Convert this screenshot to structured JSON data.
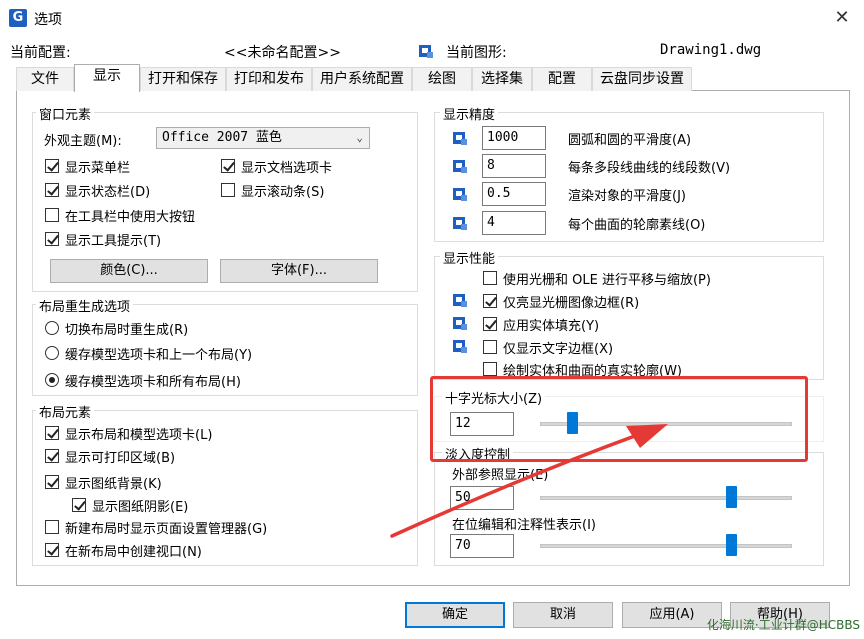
{
  "window": {
    "title": "选项",
    "logo_letter": "G",
    "close_glyph": "✕"
  },
  "profile": {
    "current_config_label": "当前配置:",
    "current_config_value": "<<未命名配置>>",
    "current_drawing_label": "当前图形:",
    "current_drawing_value": "Drawing1.dwg"
  },
  "tabs": [
    "文件",
    "显示",
    "打开和保存",
    "打印和发布",
    "用户系统配置",
    "绘图",
    "选择集",
    "配置",
    "云盘同步设置"
  ],
  "active_tab": "显示",
  "window_elements": {
    "title": "窗口元素",
    "theme_label": "外观主题(M):",
    "theme_value": "Office 2007 蓝色",
    "checkboxes": [
      {
        "label": "显示菜单栏",
        "checked": true
      },
      {
        "label": "显示文档选项卡",
        "checked": true
      },
      {
        "label": "显示状态栏(D)",
        "checked": true
      },
      {
        "label": "显示滚动条(S)",
        "checked": false
      },
      {
        "label": "在工具栏中使用大按钮",
        "checked": false
      },
      {
        "label": "显示工具提示(T)",
        "checked": true
      }
    ],
    "color_button": "颜色(C)...",
    "font_button": "字体(F)..."
  },
  "layout_regen": {
    "title": "布局重生成选项",
    "radios": [
      {
        "label": "切换布局时重生成(R)",
        "checked": false
      },
      {
        "label": "缓存模型选项卡和上一个布局(Y)",
        "checked": false
      },
      {
        "label": "缓存模型选项卡和所有布局(H)",
        "checked": true
      }
    ]
  },
  "layout_elements": {
    "title": "布局元素",
    "checkboxes": [
      {
        "label": "显示布局和模型选项卡(L)",
        "checked": true
      },
      {
        "label": "显示可打印区域(B)",
        "checked": true
      },
      {
        "label": "显示图纸背景(K)",
        "checked": true
      },
      {
        "label": "显示图纸阴影(E)",
        "checked": true
      },
      {
        "label": "新建布局时显示页面设置管理器(G)",
        "checked": false
      },
      {
        "label": "在新布局中创建视口(N)",
        "checked": true
      }
    ]
  },
  "display_resolution": {
    "title": "显示精度",
    "rows": [
      {
        "value": "1000",
        "label": "圆弧和圆的平滑度(A)"
      },
      {
        "value": "8",
        "label": "每条多段线曲线的线段数(V)"
      },
      {
        "value": "0.5",
        "label": "渲染对象的平滑度(J)"
      },
      {
        "value": "4",
        "label": "每个曲面的轮廓素线(O)"
      }
    ]
  },
  "display_performance": {
    "title": "显示性能",
    "checkboxes": [
      {
        "label": "使用光栅和 OLE 进行平移与缩放(P)",
        "checked": false
      },
      {
        "label": "仅亮显光栅图像边框(R)",
        "checked": true
      },
      {
        "label": "应用实体填充(Y)",
        "checked": true
      },
      {
        "label": "仅显示文字边框(X)",
        "checked": false
      },
      {
        "label": "绘制实体和曲面的真实轮廓(W)",
        "checked": false
      }
    ]
  },
  "crosshair": {
    "title": "十字光标大小(Z)",
    "value": "12",
    "slider_percent": 12
  },
  "fade": {
    "title": "淡入度控制",
    "xref_label": "外部参照显示(E)",
    "xref_value": "50",
    "xref_slider_percent": 76,
    "inplace_label": "在位编辑和注释性表示(I)",
    "inplace_value": "70",
    "inplace_slider_percent": 76
  },
  "buttons": {
    "ok": "确定",
    "cancel": "取消",
    "apply": "应用(A)",
    "help": "帮助(H)"
  },
  "watermark": "化海川流·工业计群@HCBBS",
  "colors": {
    "accent": "#0078d7",
    "annotation": "#e53935",
    "icon_blue": "#1f5fbf"
  }
}
